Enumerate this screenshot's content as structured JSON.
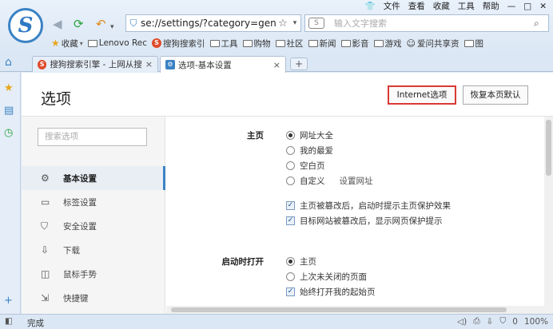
{
  "menu": [
    "文件",
    "查看",
    "收藏",
    "工具",
    "帮助"
  ],
  "address": {
    "url": "se://settings/?category=gen"
  },
  "search": {
    "placeholder": "输入文字搜索",
    "engine_icon": "S"
  },
  "bookmarks": [
    {
      "label": "收藏",
      "icon": "star"
    },
    {
      "label": "Lenovo Rec",
      "icon": "folder"
    },
    {
      "label": "搜狗搜索引",
      "icon": "sogou"
    },
    {
      "label": "工具",
      "icon": "folder"
    },
    {
      "label": "购物",
      "icon": "folder"
    },
    {
      "label": "社区",
      "icon": "folder"
    },
    {
      "label": "新闻",
      "icon": "folder"
    },
    {
      "label": "影音",
      "icon": "folder"
    },
    {
      "label": "游戏",
      "icon": "folder"
    },
    {
      "label": "爱问共享资",
      "icon": "avatar"
    },
    {
      "label": "图",
      "icon": "folder"
    }
  ],
  "tabs": [
    {
      "label": "搜狗搜索引擎 - 上网从搜",
      "active": false
    },
    {
      "label": "选项-基本设置",
      "active": true
    }
  ],
  "page": {
    "title": "选项",
    "internet_button": "Internet选项",
    "restore_button": "恢复本页默认",
    "search_placeholder": "搜索选项"
  },
  "sidebar": [
    {
      "label": "基本设置",
      "icon": "⚙",
      "active": true
    },
    {
      "label": "标签设置",
      "icon": "▭",
      "active": false
    },
    {
      "label": "安全设置",
      "icon": "⛉",
      "active": false
    },
    {
      "label": "下载",
      "icon": "⇩",
      "active": false
    },
    {
      "label": "鼠标手势",
      "icon": "◫",
      "active": false
    },
    {
      "label": "快捷键",
      "icon": "⇲",
      "active": false
    }
  ],
  "homepage": {
    "label": "主页",
    "options": [
      "网址大全",
      "我的最爱",
      "空白页",
      "自定义"
    ],
    "selected": 0,
    "custom_link": "设置网址",
    "checks": [
      "主页被篡改后，启动时提示主页保护效果",
      "目标网站被篡改后，显示网页保护提示"
    ]
  },
  "startup": {
    "label": "启动时打开",
    "options": [
      "主页",
      "上次未关闭的页面"
    ],
    "selected": 0,
    "check": "始终打开我的起始页"
  },
  "status": {
    "text": "完成",
    "zoom": "100%",
    "count": "0"
  }
}
